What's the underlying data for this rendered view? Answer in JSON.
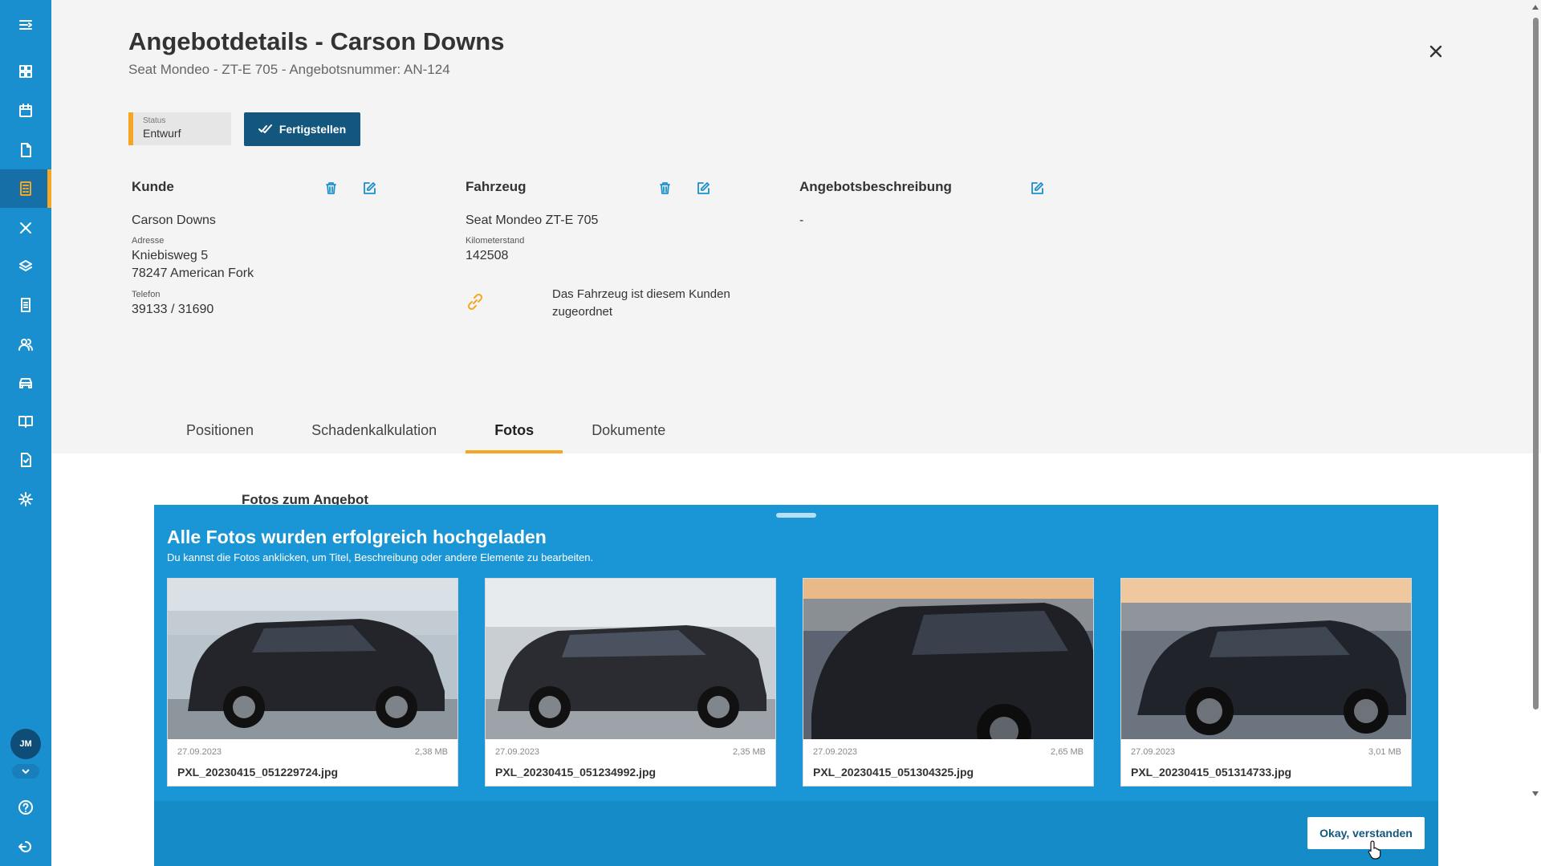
{
  "sidebar": {
    "avatar_initials": "JM",
    "items": [
      "menu-toggle",
      "dashboard",
      "calendar",
      "documents",
      "offers",
      "tools",
      "layers",
      "invoices",
      "customers",
      "vehicles",
      "catalog",
      "reports",
      "settings"
    ]
  },
  "header": {
    "title": "Angebotdetails - Carson Downs",
    "subtitle": "Seat Mondeo - ZT-E 705 - Angebotsnummer: AN-124"
  },
  "status": {
    "label": "Status",
    "value": "Entwurf",
    "accent": "#f5a623"
  },
  "actions": {
    "finish_label": "Fertigstellen"
  },
  "customer": {
    "heading": "Kunde",
    "name": "Carson Downs",
    "address_label": "Adresse",
    "street": "Kniebisweg 5",
    "city": "78247 American Fork",
    "phone_label": "Telefon",
    "phone": "39133 / 31690"
  },
  "vehicle": {
    "heading": "Fahrzeug",
    "name": "Seat Mondeo ZT-E 705",
    "mileage_label": "Kilometerstand",
    "mileage": "142508",
    "link_note": "Das Fahrzeug ist diesem Kunden zugeordnet"
  },
  "description": {
    "heading": "Angebotsbeschreibung",
    "value": "-"
  },
  "tabs": [
    {
      "label": "Positionen",
      "active": false
    },
    {
      "label": "Schadenkalkulation",
      "active": false
    },
    {
      "label": "Fotos",
      "active": true
    },
    {
      "label": "Dokumente",
      "active": false
    }
  ],
  "photos_heading": "Fotos zum Angebot",
  "upload_notice": {
    "title": "Alle Fotos wurden erfolgreich hochgeladen",
    "text": "Du kannst die Fotos anklicken, um Titel, Beschreibung oder andere Elemente zu bearbeiten.",
    "button_label": "Okay, verstanden",
    "photos": [
      {
        "date": "27.09.2023",
        "size": "2,38 MB",
        "name": "PXL_20230415_051229724.jpg"
      },
      {
        "date": "27.09.2023",
        "size": "2,35 MB",
        "name": "PXL_20230415_051234992.jpg"
      },
      {
        "date": "27.09.2023",
        "size": "2,65 MB",
        "name": "PXL_20230415_051304325.jpg"
      },
      {
        "date": "27.09.2023",
        "size": "3,01 MB",
        "name": "PXL_20230415_051314733.jpg"
      }
    ]
  },
  "colors": {
    "sidebar": "#1a8fd0",
    "primary_button": "#14577e",
    "overlay": "#1a96d6",
    "accent": "#f5a623"
  }
}
